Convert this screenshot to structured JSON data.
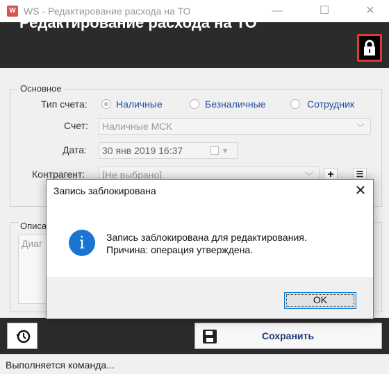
{
  "window": {
    "app_icon": "W",
    "title": "WS - Редактирование расхода на ТО",
    "minimize": "—",
    "maximize": "☐",
    "close": "✕"
  },
  "header": {
    "title": "Редактирование расхода на ТО",
    "lock_icon": "lock-icon"
  },
  "main_group": {
    "label": "Основное",
    "account_type_label": "Тип счета:",
    "account_types": [
      "Наличные",
      "Безналичные",
      "Сотрудник"
    ],
    "selected_account_type": "Наличные",
    "account_label": "Счет:",
    "account_value": "Наличные МСК",
    "date_label": "Дата:",
    "date_value": "30 янв 2019  16:37",
    "counterparty_label": "Контрагент:",
    "counterparty_value": "[Не выбрано]"
  },
  "desc_group": {
    "label": "Описа",
    "placeholder": "Диаг"
  },
  "toolbar": {
    "save_label": "Сохранить"
  },
  "status": {
    "text": "Выполняется команда..."
  },
  "dialog": {
    "title": "Запись заблокирована",
    "close": "✕",
    "icon": "i",
    "message_line1": "Запись заблокирована для редактирования.",
    "message_line2": "Причина: операция утверждена.",
    "ok_label": "OK"
  },
  "colors": {
    "header_bg": "#2b2b2b",
    "lock_highlight": "#e0382c",
    "info_blue": "#1a75d2",
    "save_text": "#1f3a7a"
  }
}
